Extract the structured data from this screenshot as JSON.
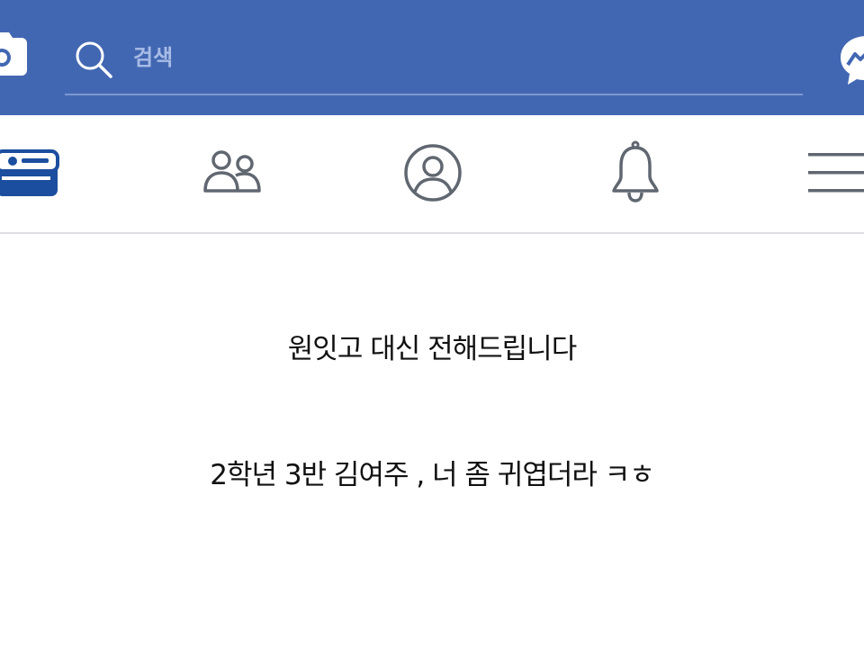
{
  "header": {
    "search_placeholder": "검색",
    "icons": {
      "left": "camera-icon",
      "search": "search-icon",
      "right": "messenger-icon"
    },
    "colors": {
      "bar": "#4267b2",
      "placeholder": "#a8bce6"
    }
  },
  "nav": {
    "tabs": [
      {
        "name": "news-feed",
        "icon": "news-feed-icon",
        "active": true
      },
      {
        "name": "friends",
        "icon": "friends-icon",
        "active": false
      },
      {
        "name": "profile",
        "icon": "profile-icon",
        "active": false
      },
      {
        "name": "notifications",
        "icon": "bell-icon",
        "active": false
      },
      {
        "name": "menu",
        "icon": "hamburger-menu-icon",
        "active": false
      }
    ],
    "colors": {
      "active": "#1c4e9f",
      "inactive": "#606770"
    }
  },
  "post": {
    "lines": [
      "원잇고 대신 전해드립니다",
      "2학년 3반 김여주 , 너 좀 귀엽더라 ㅋㅎ"
    ]
  }
}
